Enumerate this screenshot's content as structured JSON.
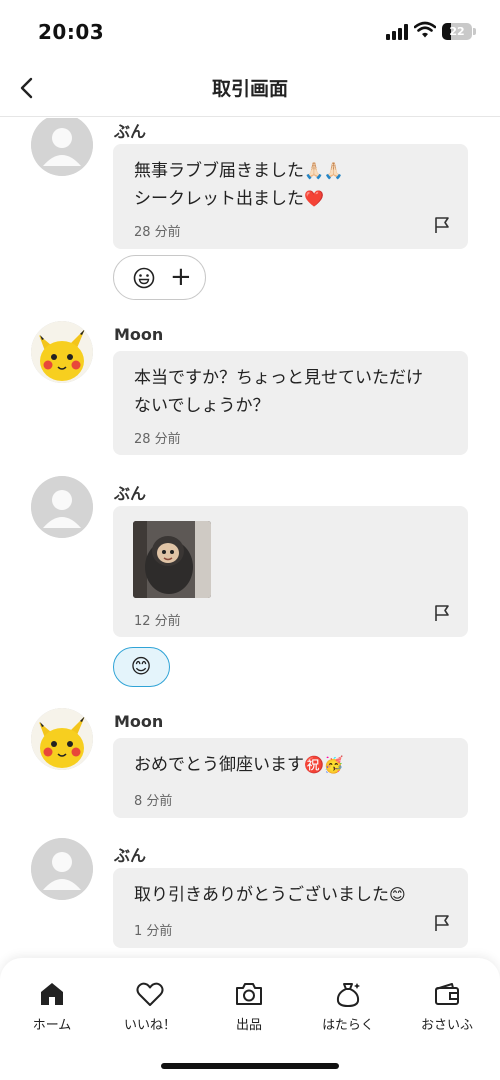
{
  "status_bar": {
    "time": "20:03",
    "battery": "22"
  },
  "header": {
    "title": "取引画面"
  },
  "messages": [
    {
      "sender": "ぶん",
      "line1": "無事ラブブ届きました",
      "line1_emoji": "🙏🏻🙏🏻",
      "line2": "シークレット出ました",
      "line2_emoji": "❤️",
      "time": "28 分前"
    },
    {
      "sender": "Moon",
      "line1": "本当ですか？ちょっと見せていただけ",
      "line2": "ないでしょうか？",
      "time": "28 分前"
    },
    {
      "sender": "ぶん",
      "time": "12 分前"
    },
    {
      "sender": "Moon",
      "line1": "おめでとう御座います",
      "line1_emoji": "㊗️🥳",
      "time": "8 分前"
    },
    {
      "sender": "ぶん",
      "line1": "取り引きありがとうございました",
      "line1_emoji": "😊",
      "time": "1 分前"
    }
  ],
  "reactions": {
    "add_plus": "+",
    "pill_emoji": "😊",
    "add_face": "😮"
  },
  "tabs": [
    {
      "label": "ホーム",
      "icon": "home-icon"
    },
    {
      "label": "いいね！",
      "icon": "heart-icon"
    },
    {
      "label": "出品",
      "icon": "camera-icon"
    },
    {
      "label": "はたらく",
      "icon": "money-bag-icon"
    },
    {
      "label": "おさいふ",
      "icon": "wallet-icon"
    }
  ]
}
